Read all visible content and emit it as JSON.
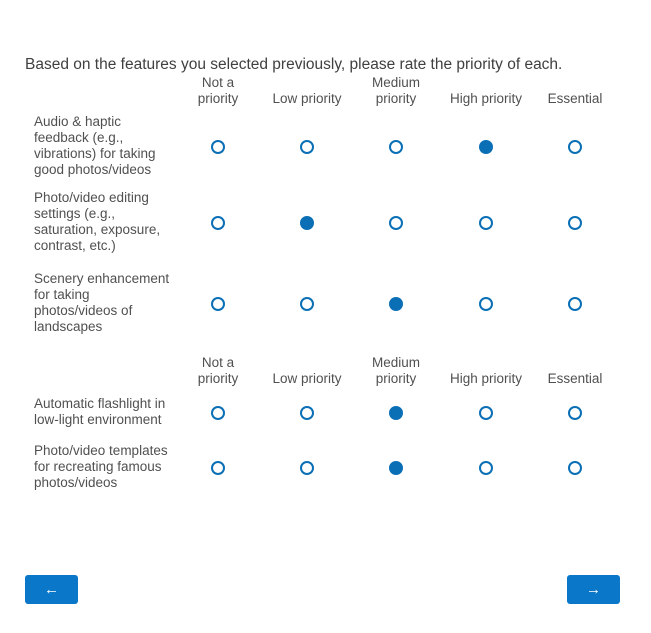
{
  "question": "Based on the features you selected previously, please rate the priority of each.",
  "columns": [
    {
      "line1": "Not a",
      "line2": "priority"
    },
    {
      "line1": "",
      "line2": "Low priority"
    },
    {
      "line1": "Medium",
      "line2": "priority"
    },
    {
      "line1": "",
      "line2": "High priority"
    },
    {
      "line1": "",
      "line2": "Essential"
    }
  ],
  "rows": [
    {
      "label": [
        "Audio & haptic",
        "feedback (e.g.,",
        "vibrations) for taking",
        "good photos/videos"
      ],
      "selected": 3
    },
    {
      "label": [
        "Photo/video editing",
        "settings (e.g.,",
        "saturation, exposure,",
        "contrast, etc.)"
      ],
      "selected": 1
    },
    {
      "label": [
        "Scenery enhancement",
        "for taking",
        "photos/videos of",
        "landscapes"
      ],
      "selected": 2
    },
    {
      "label": [
        "Automatic flashlight in",
        "low-light environment"
      ],
      "selected": 2
    },
    {
      "label": [
        "Photo/video templates",
        "for recreating famous",
        "photos/videos"
      ],
      "selected": 2
    }
  ],
  "nav": {
    "back_label": "←",
    "next_label": "→"
  },
  "colors": {
    "accent": "#0a6fb5",
    "button": "#0a77c8"
  }
}
